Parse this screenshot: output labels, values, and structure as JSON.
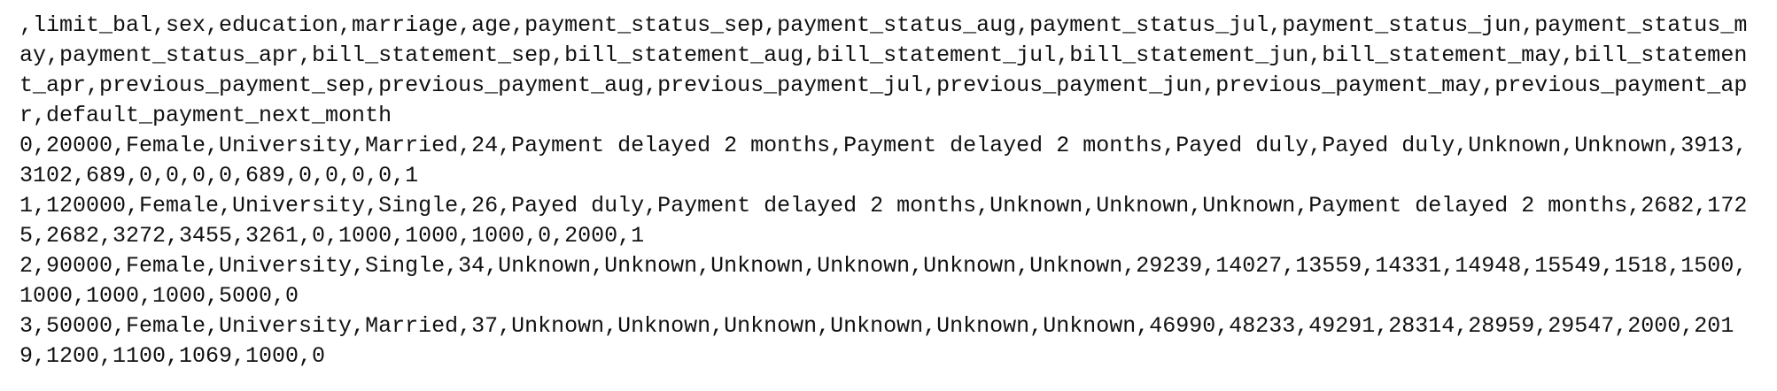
{
  "document": {
    "lines": [
      ",limit_bal,sex,education,marriage,age,payment_status_sep,payment_status_aug,payment_status_jul,payment_status_jun,payment_status_may,payment_status_apr,bill_statement_sep,bill_statement_aug,bill_statement_jul,bill_statement_jun,bill_statement_may,bill_statement_apr,previous_payment_sep,previous_payment_aug,previous_payment_jul,previous_payment_jun,previous_payment_may,previous_payment_apr,default_payment_next_month",
      "0,20000,Female,University,Married,24,Payment delayed 2 months,Payment delayed 2 months,Payed duly,Payed duly,Unknown,Unknown,3913,3102,689,0,0,0,0,689,0,0,0,0,1",
      "1,120000,Female,University,Single,26,Payed duly,Payment delayed 2 months,Unknown,Unknown,Unknown,Payment delayed 2 months,2682,1725,2682,3272,3455,3261,0,1000,1000,1000,0,2000,1",
      "2,90000,Female,University,Single,34,Unknown,Unknown,Unknown,Unknown,Unknown,Unknown,29239,14027,13559,14331,14948,15549,1518,1500,1000,1000,1000,5000,0",
      "3,50000,Female,University,Married,37,Unknown,Unknown,Unknown,Unknown,Unknown,Unknown,46990,48233,49291,28314,28959,29547,2000,2019,1200,1100,1069,1000,0"
    ]
  }
}
